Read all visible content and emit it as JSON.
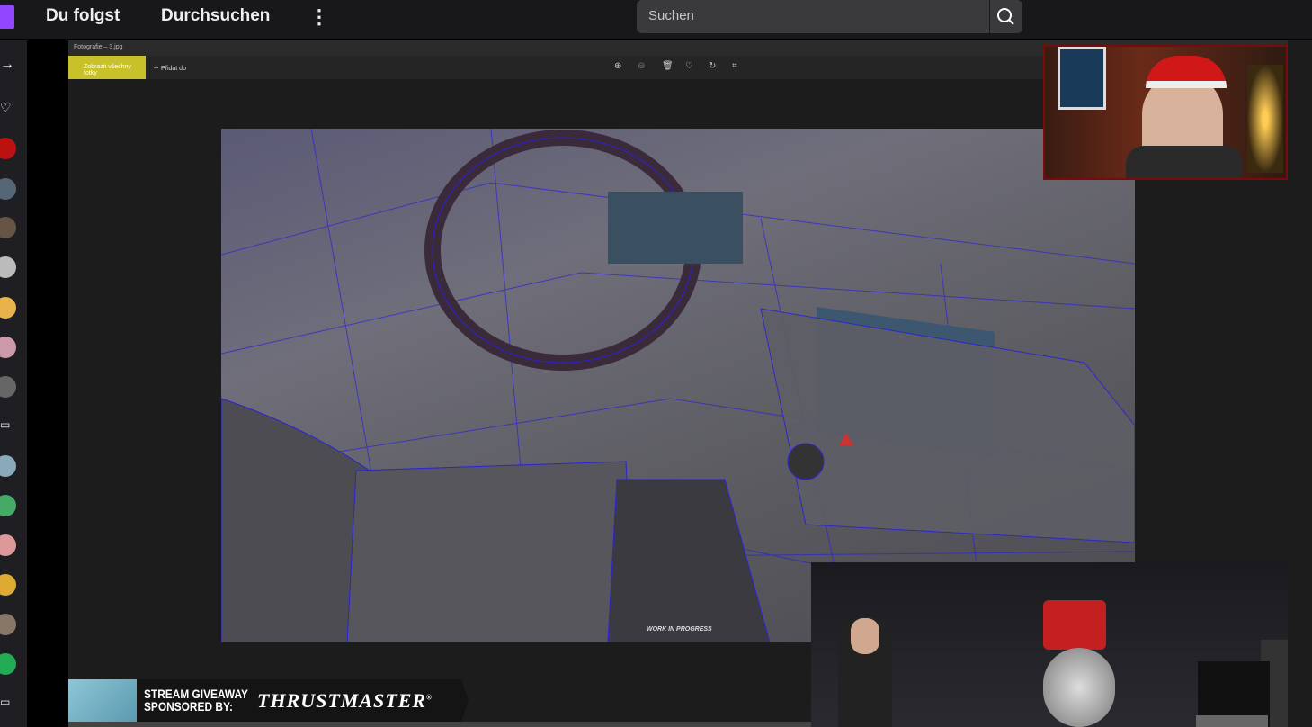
{
  "topbar": {
    "following": "Du folgst",
    "browse": "Durchsuchen",
    "more": "⋮",
    "search_placeholder": "Suchen"
  },
  "viewer": {
    "file_title": "Fotografie – 3.jpg",
    "show_all": "Zobrazit všechny fotky",
    "add_to": "Přidat do"
  },
  "photo": {
    "watermark": "WORK IN PROGRESS"
  },
  "banner": {
    "line1": "STREAM GIVEAWAY",
    "line2": "SPONSORED BY:",
    "brand": "THRUSTMASTER",
    "reg": "®"
  },
  "colors": {
    "accent": "#9147ff",
    "viewer_button": "#c9c12a",
    "cam_border": "#7a0b0b"
  }
}
